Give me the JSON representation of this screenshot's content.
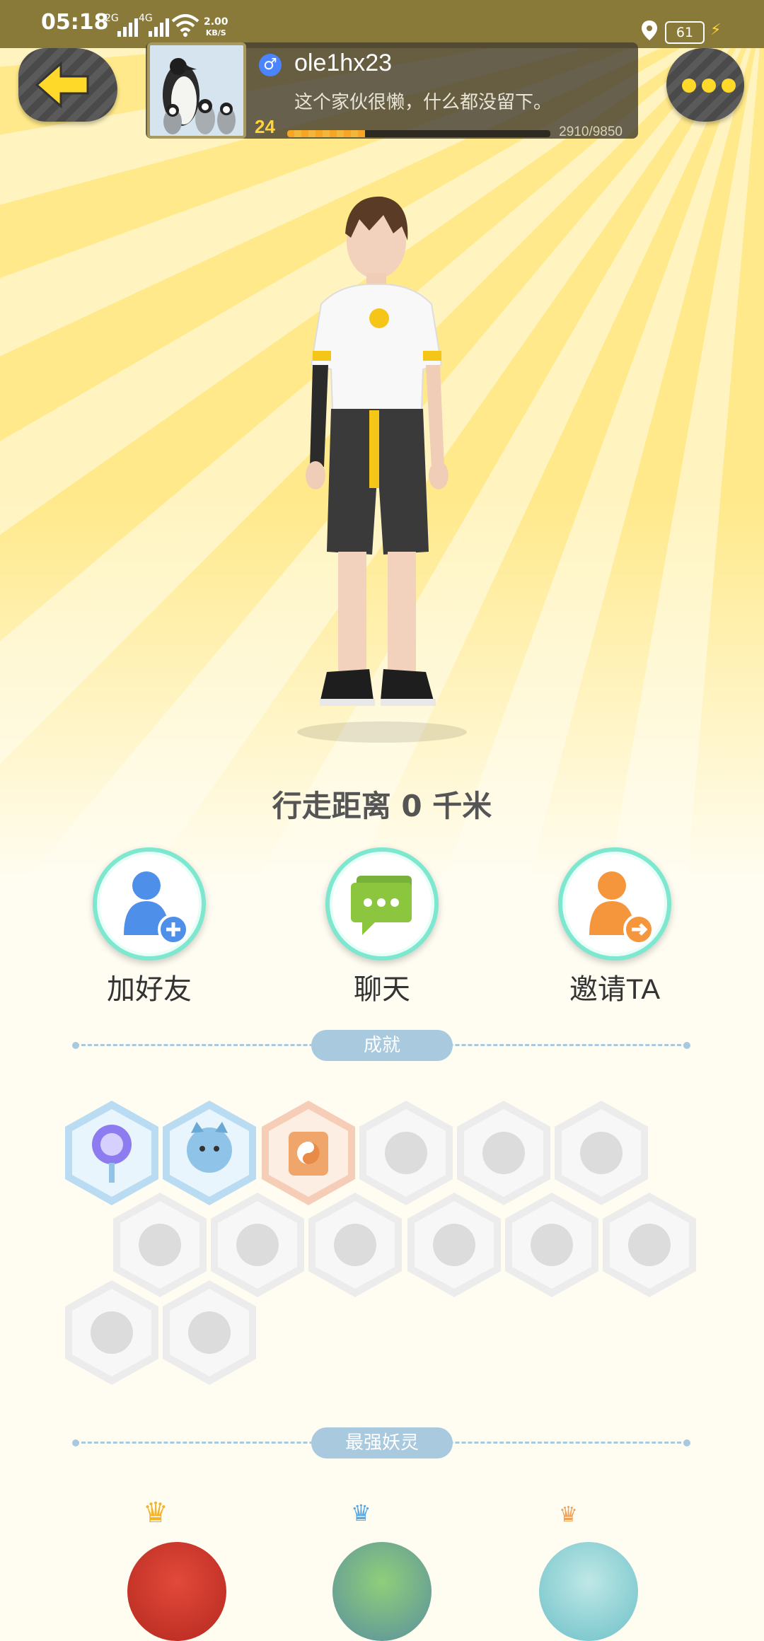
{
  "status_bar": {
    "time": "05:18",
    "network1": "2G",
    "network2": "4G",
    "speed_value": "2.00",
    "speed_unit": "KB/S",
    "battery": "61",
    "icons": [
      "signal-icon",
      "wifi-icon",
      "location-icon",
      "battery-icon",
      "charging-icon"
    ]
  },
  "profile": {
    "username": "ole1hx23",
    "gender_symbol": "♂",
    "signature": "这个家伙很懒，什么都没留下。",
    "level": "24",
    "exp_text": "2910/9850",
    "exp_fraction": 0.2954
  },
  "distance_text": "行走距离 0 千米",
  "actions": [
    {
      "label": "加好友",
      "icon": "add-friend-icon"
    },
    {
      "label": "聊天",
      "icon": "chat-icon"
    },
    {
      "label": "邀请TA",
      "icon": "invite-icon"
    }
  ],
  "sections": {
    "achievements_title": "成就",
    "strongest_title": "最强妖灵"
  },
  "colors": {
    "accent_yellow": "#ffd92a",
    "pill_blue": "#a9c9de",
    "ring_teal": "#7ee7cf",
    "friend_blue": "#4e8fea",
    "chat_green": "#8cc63f",
    "invite_orange": "#f5963c"
  }
}
